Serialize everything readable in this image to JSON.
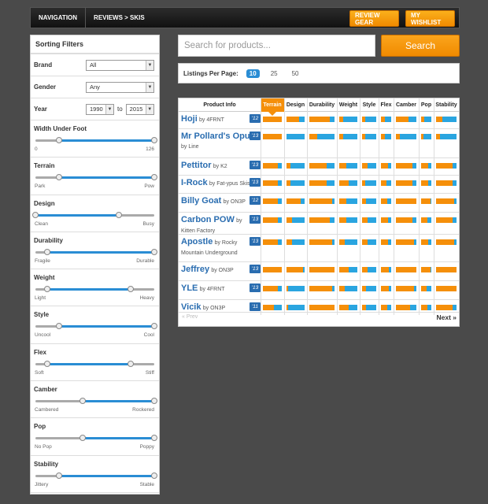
{
  "topbar": {
    "navigation": "NAVIGATION",
    "breadcrumb": "REVIEWS > SKIS",
    "review_gear": "REVIEW GEAR",
    "wishlist": "MY WISHLIST"
  },
  "sidebar": {
    "title": "Sorting Filters",
    "brand": {
      "label": "Brand",
      "value": "All"
    },
    "gender": {
      "label": "Gender",
      "value": "Any"
    },
    "year": {
      "label": "Year",
      "from": "1990",
      "to_label": "to",
      "to": "2015"
    },
    "sliders": [
      {
        "label": "Width Under Foot",
        "lo": "0",
        "hi": "126",
        "min": 0.2,
        "max": 1.0
      },
      {
        "label": "Terrain",
        "lo": "Park",
        "hi": "Pow",
        "min": 0.2,
        "max": 1.0
      },
      {
        "label": "Design",
        "lo": "Clean",
        "hi": "Busy",
        "min": 0.0,
        "max": 0.7
      },
      {
        "label": "Durability",
        "lo": "Fragile",
        "hi": "Durable",
        "min": 0.1,
        "max": 1.0
      },
      {
        "label": "Weight",
        "lo": "Light",
        "hi": "Heavy",
        "min": 0.1,
        "max": 0.8
      },
      {
        "label": "Style",
        "lo": "Uncool",
        "hi": "Cool",
        "min": 0.2,
        "max": 1.0
      },
      {
        "label": "Flex",
        "lo": "Soft",
        "hi": "Stiff",
        "min": 0.1,
        "max": 0.8
      },
      {
        "label": "Camber",
        "lo": "Cambered",
        "hi": "Rockered",
        "min": 0.4,
        "max": 1.0
      },
      {
        "label": "Pop",
        "lo": "No Pop",
        "hi": "Poppy",
        "min": 0.4,
        "max": 1.0
      },
      {
        "label": "Stability",
        "lo": "Jittery",
        "hi": "Stable",
        "min": 0.2,
        "max": 1.0
      }
    ]
  },
  "search": {
    "placeholder": "Search for products...",
    "button": "Search"
  },
  "listings": {
    "label": "Listings Per Page:",
    "options": [
      "10",
      "25",
      "50"
    ],
    "selected": "10"
  },
  "table": {
    "headers": [
      "Product Info",
      "Terrain",
      "Design",
      "Durability",
      "Weight",
      "Style",
      "Flex",
      "Camber",
      "Pop",
      "Stability"
    ],
    "active_header": "Terrain",
    "prev": "« Prev",
    "next": "Next »",
    "rows": [
      {
        "name": "Hoji",
        "by": "by 4FRNT",
        "year": "'12",
        "values": [
          1.0,
          0.7,
          0.8,
          0.2,
          0.2,
          0.4,
          0.6,
          0.3,
          0.3
        ]
      },
      {
        "name": "Mr Pollard's Opus",
        "by": "by Line",
        "year": "'13",
        "values": [
          1.0,
          0.0,
          0.3,
          0.2,
          0.2,
          0.4,
          0.2,
          0.2,
          0.2
        ]
      },
      {
        "name": "Pettitor",
        "by": "by K2",
        "year": "'13",
        "values": [
          0.8,
          0.2,
          0.7,
          0.4,
          0.4,
          0.7,
          0.8,
          0.7,
          0.8
        ]
      },
      {
        "name": "I-Rock",
        "by": "by Fat-ypus Skis",
        "year": "'13",
        "values": [
          0.8,
          0.2,
          0.7,
          0.5,
          0.2,
          0.5,
          0.8,
          0.7,
          0.8
        ]
      },
      {
        "name": "Billy Goat",
        "by": "by ON3P",
        "year": "'12",
        "values": [
          0.8,
          0.8,
          0.9,
          0.4,
          0.3,
          0.6,
          1.0,
          0.9,
          0.9
        ]
      },
      {
        "name": "Carbon POW",
        "by": "by Kitten Factory",
        "year": "'13",
        "values": [
          0.8,
          0.3,
          0.8,
          0.4,
          0.4,
          0.7,
          0.8,
          0.6,
          0.8
        ]
      },
      {
        "name": "Apostle",
        "by": "by Rocky Mountain Underground",
        "year": "'13",
        "values": [
          0.8,
          0.3,
          0.9,
          0.3,
          0.4,
          0.7,
          0.9,
          0.7,
          0.9
        ]
      },
      {
        "name": "Jeffrey",
        "by": "by ON3P",
        "year": "'13",
        "values": [
          1.0,
          0.9,
          1.0,
          0.5,
          0.4,
          0.8,
          1.0,
          0.9,
          1.0
        ]
      },
      {
        "name": "YLE",
        "by": "by 4FRNT",
        "year": "'13",
        "values": [
          0.8,
          0.1,
          0.9,
          0.3,
          0.3,
          0.8,
          0.9,
          0.5,
          1.0
        ]
      },
      {
        "name": "Vicik",
        "by": "by ON3P",
        "year": "'11",
        "values": [
          0.6,
          0.1,
          1.0,
          0.5,
          0.3,
          0.6,
          0.7,
          0.6,
          0.8
        ]
      }
    ]
  },
  "colors": {
    "orange": "#f58f0a",
    "blue": "#2aa5e0",
    "link": "#2a6db0"
  }
}
